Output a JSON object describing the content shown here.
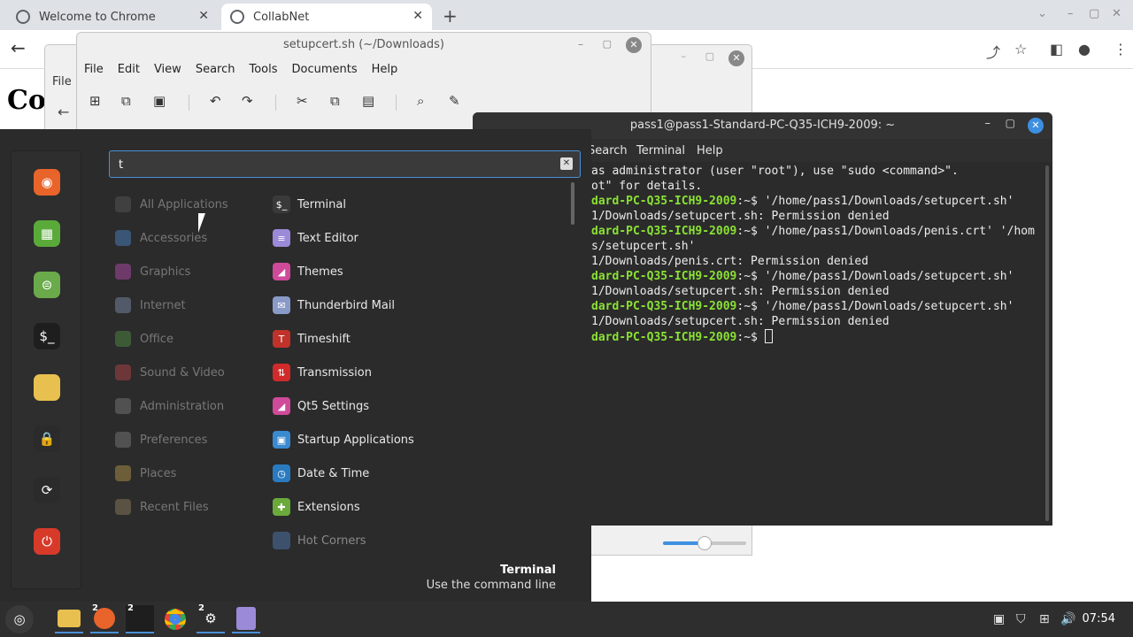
{
  "chrome": {
    "tabs": [
      {
        "label": "Welcome to Chrome"
      },
      {
        "label": "CollabNet"
      }
    ],
    "new_tab_icon": "plus-icon",
    "page_heading": "Col"
  },
  "file_window": {
    "menu_file": "File",
    "volume_slider_fraction": 0.5
  },
  "editor": {
    "title": "setupcert.sh (~/Downloads)",
    "menu": [
      "File",
      "Edit",
      "View",
      "Search",
      "Tools",
      "Documents",
      "Help"
    ]
  },
  "terminal": {
    "title": "pass1@pass1-Standard-PC-Q35-ICH9-2009: ~",
    "menu": [
      "Search",
      "Terminal",
      "Help"
    ],
    "lines": [
      {
        "p": "",
        "t": "as administrator (user \"root\"), use \"sudo <command>\"."
      },
      {
        "p": "",
        "t": "ot\" for details."
      },
      {
        "p": "",
        "t": ""
      },
      {
        "p": "dard-PC-Q35-ICH9-2009",
        "t": ":~$ '/home/pass1/Downloads/setupcert.sh'"
      },
      {
        "p": "",
        "t": "1/Downloads/setupcert.sh: Permission denied"
      },
      {
        "p": "dard-PC-Q35-ICH9-2009",
        "t": ":~$ '/home/pass1/Downloads/penis.crt' '/hom"
      },
      {
        "p": "",
        "t": "s/setupcert.sh'"
      },
      {
        "p": "",
        "t": "1/Downloads/penis.crt: Permission denied"
      },
      {
        "p": "dard-PC-Q35-ICH9-2009",
        "t": ":~$ '/home/pass1/Downloads/setupcert.sh'"
      },
      {
        "p": "",
        "t": "1/Downloads/setupcert.sh: Permission denied"
      },
      {
        "p": "dard-PC-Q35-ICH9-2009",
        "t": ":~$ '/home/pass1/Downloads/setupcert.sh'"
      },
      {
        "p": "",
        "t": "1/Downloads/setupcert.sh: Permission denied"
      },
      {
        "p": "dard-PC-Q35-ICH9-2009",
        "t": ":~$ "
      }
    ]
  },
  "menu": {
    "search_value": "t",
    "categories": [
      {
        "label": "All Applications",
        "icon": "grid-icon",
        "color": "#555555"
      },
      {
        "label": "Accessories",
        "icon": "tools-icon",
        "color": "#4a7fc0"
      },
      {
        "label": "Graphics",
        "icon": "graphics-icon",
        "color": "#b04aa8"
      },
      {
        "label": "Internet",
        "icon": "cloud-icon",
        "color": "#7a8aa8"
      },
      {
        "label": "Office",
        "icon": "office-icon",
        "color": "#4f8a44"
      },
      {
        "label": "Sound & Video",
        "icon": "play-icon",
        "color": "#b0444a"
      },
      {
        "label": "Administration",
        "icon": "admin-icon",
        "color": "#777777"
      },
      {
        "label": "Preferences",
        "icon": "preferences-icon",
        "color": "#777777"
      },
      {
        "label": "Places",
        "icon": "folder-icon",
        "color": "#b0924a"
      },
      {
        "label": "Recent Files",
        "icon": "recent-icon",
        "color": "#8a7a5a"
      }
    ],
    "apps": [
      {
        "label": "Terminal",
        "icon": "terminal-icon",
        "glyph": "$_",
        "color": "#3a3a3a",
        "dim": false
      },
      {
        "label": "Text Editor",
        "icon": "text-editor-icon",
        "glyph": "≡",
        "color": "#9a8ad8",
        "dim": false
      },
      {
        "label": "Themes",
        "icon": "themes-icon",
        "glyph": "◢",
        "color": "#d04a9a",
        "dim": false
      },
      {
        "label": "Thunderbird Mail",
        "icon": "mail-icon",
        "glyph": "✉",
        "color": "#8a9ac8",
        "dim": false
      },
      {
        "label": "Timeshift",
        "icon": "timeshift-icon",
        "glyph": "T",
        "color": "#c0322a",
        "dim": false
      },
      {
        "label": "Transmission",
        "icon": "transmission-icon",
        "glyph": "⇅",
        "color": "#d02a2a",
        "dim": false
      },
      {
        "label": "Qt5 Settings",
        "icon": "qt5-settings-icon",
        "glyph": "◢",
        "color": "#d04a9a",
        "dim": false
      },
      {
        "label": "Startup Applications",
        "icon": "startup-icon",
        "glyph": "▣",
        "color": "#3a8ad0",
        "dim": false
      },
      {
        "label": "Date & Time",
        "icon": "clock-icon",
        "glyph": "◷",
        "color": "#2a7ac0",
        "dim": false
      },
      {
        "label": "Extensions",
        "icon": "extensions-icon",
        "glyph": "✚",
        "color": "#6aaa3a",
        "dim": false
      },
      {
        "label": "Hot Corners",
        "icon": "hot-corners-icon",
        "glyph": "",
        "color": "#4a6a9a",
        "dim": true
      }
    ],
    "description_title": "Terminal",
    "description_text": "Use the command line"
  },
  "favorites": [
    {
      "icon": "firefox-icon",
      "glyph": "◉",
      "color": "#e8642a"
    },
    {
      "icon": "software-manager-icon",
      "glyph": "▦",
      "color": "#5aaa3a"
    },
    {
      "icon": "settings-toggle-icon",
      "glyph": "⊜",
      "color": "#6aaa4a"
    },
    {
      "icon": "terminal-icon",
      "glyph": "$_",
      "color": "#1e1e1e"
    },
    {
      "icon": "folder-icon",
      "glyph": "",
      "color": "#e8c050"
    },
    {
      "icon": "lock-icon",
      "glyph": "🔒",
      "color": "#2b2b2b"
    },
    {
      "icon": "logout-icon",
      "glyph": "⟳",
      "color": "#2b2b2b"
    },
    {
      "icon": "power-icon",
      "glyph": "⏻",
      "color": "#d83a2a"
    }
  ],
  "taskbar": {
    "clock": "07:54",
    "badges": {
      "firefox": "2",
      "terminal": "2",
      "settings": "2"
    }
  }
}
